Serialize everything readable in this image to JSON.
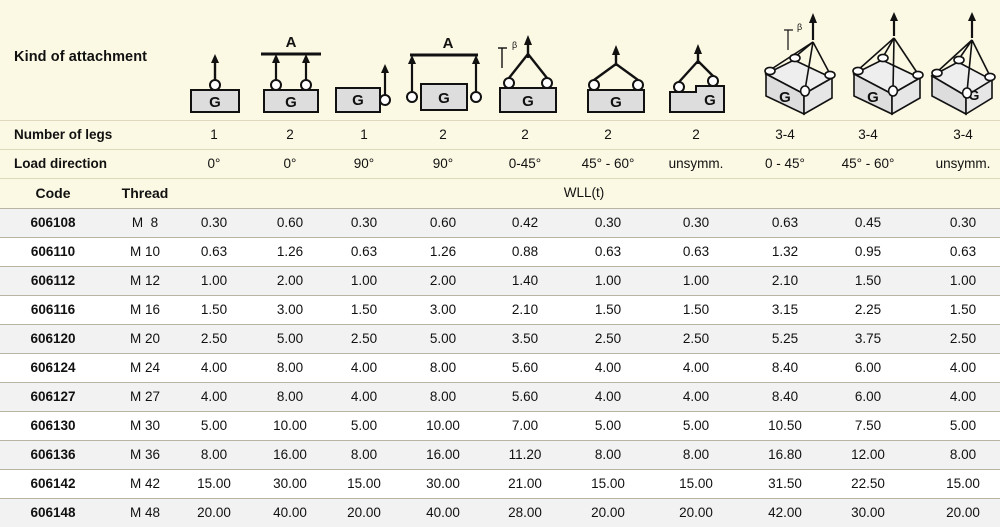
{
  "header": {
    "attachment_label": "Kind of attachment",
    "legs_label": "Number of legs",
    "direction_label": "Load direction",
    "code_label": "Code",
    "thread_label": "Thread",
    "wll_label": "WLL(t)",
    "angle_symbol": "β",
    "load_symbol": "G",
    "beam_symbol": "A",
    "columns": [
      {
        "legs": "1",
        "direction": "0°",
        "diagram": "single-leg-vertical-lift-icon"
      },
      {
        "legs": "2",
        "direction": "0°",
        "diagram": "two-leg-parallel-beam-lift-icon"
      },
      {
        "legs": "1",
        "direction": "90°",
        "diagram": "single-leg-side-lift-icon"
      },
      {
        "legs": "2",
        "direction": "90°",
        "diagram": "two-leg-side-beam-lift-icon"
      },
      {
        "legs": "2",
        "direction": "0-45°",
        "diagram": "two-leg-angled-sling-icon"
      },
      {
        "legs": "2",
        "direction": "45° - 60°",
        "diagram": "two-leg-wide-angled-sling-icon"
      },
      {
        "legs": "2",
        "direction": "unsymm.",
        "diagram": "two-leg-unsymmetric-load-icon"
      },
      {
        "legs": "3-4",
        "direction": "0 - 45°",
        "diagram": "four-leg-box-sling-icon"
      },
      {
        "legs": "3-4",
        "direction": "45° - 60°",
        "diagram": "four-leg-box-wide-sling-icon"
      },
      {
        "legs": "3-4",
        "direction": "unsymm.",
        "diagram": "four-leg-box-unsymmetric-icon"
      }
    ]
  },
  "rows": [
    {
      "code": "606108",
      "thread": "M  8",
      "wll": [
        "0.30",
        "0.60",
        "0.30",
        "0.60",
        "0.42",
        "0.30",
        "0.30",
        "0.63",
        "0.45",
        "0.30"
      ]
    },
    {
      "code": "606110",
      "thread": "M 10",
      "wll": [
        "0.63",
        "1.26",
        "0.63",
        "1.26",
        "0.88",
        "0.63",
        "0.63",
        "1.32",
        "0.95",
        "0.63"
      ]
    },
    {
      "code": "606112",
      "thread": "M 12",
      "wll": [
        "1.00",
        "2.00",
        "1.00",
        "2.00",
        "1.40",
        "1.00",
        "1.00",
        "2.10",
        "1.50",
        "1.00"
      ]
    },
    {
      "code": "606116",
      "thread": "M 16",
      "wll": [
        "1.50",
        "3.00",
        "1.50",
        "3.00",
        "2.10",
        "1.50",
        "1.50",
        "3.15",
        "2.25",
        "1.50"
      ]
    },
    {
      "code": "606120",
      "thread": "M 20",
      "wll": [
        "2.50",
        "5.00",
        "2.50",
        "5.00",
        "3.50",
        "2.50",
        "2.50",
        "5.25",
        "3.75",
        "2.50"
      ]
    },
    {
      "code": "606124",
      "thread": "M 24",
      "wll": [
        "4.00",
        "8.00",
        "4.00",
        "8.00",
        "5.60",
        "4.00",
        "4.00",
        "8.40",
        "6.00",
        "4.00"
      ]
    },
    {
      "code": "606127",
      "thread": "M 27",
      "wll": [
        "4.00",
        "8.00",
        "4.00",
        "8.00",
        "5.60",
        "4.00",
        "4.00",
        "8.40",
        "6.00",
        "4.00"
      ]
    },
    {
      "code": "606130",
      "thread": "M 30",
      "wll": [
        "5.00",
        "10.00",
        "5.00",
        "10.00",
        "7.00",
        "5.00",
        "5.00",
        "10.50",
        "7.50",
        "5.00"
      ]
    },
    {
      "code": "606136",
      "thread": "M 36",
      "wll": [
        "8.00",
        "16.00",
        "8.00",
        "16.00",
        "11.20",
        "8.00",
        "8.00",
        "16.80",
        "12.00",
        "8.00"
      ]
    },
    {
      "code": "606142",
      "thread": "M 42",
      "wll": [
        "15.00",
        "30.00",
        "15.00",
        "30.00",
        "21.00",
        "15.00",
        "15.00",
        "31.50",
        "22.50",
        "15.00"
      ]
    },
    {
      "code": "606148",
      "thread": "M 48",
      "wll": [
        "20.00",
        "40.00",
        "20.00",
        "40.00",
        "28.00",
        "20.00",
        "20.00",
        "42.00",
        "30.00",
        "20.00"
      ]
    }
  ],
  "colors": {
    "header_bg": "#fbf8e3",
    "row_alt_bg": "#f2f2f2",
    "row_bg": "#ffffff",
    "rule": "#b9b5a2",
    "text": "#111111",
    "load_block_fill": "#dddddd"
  }
}
